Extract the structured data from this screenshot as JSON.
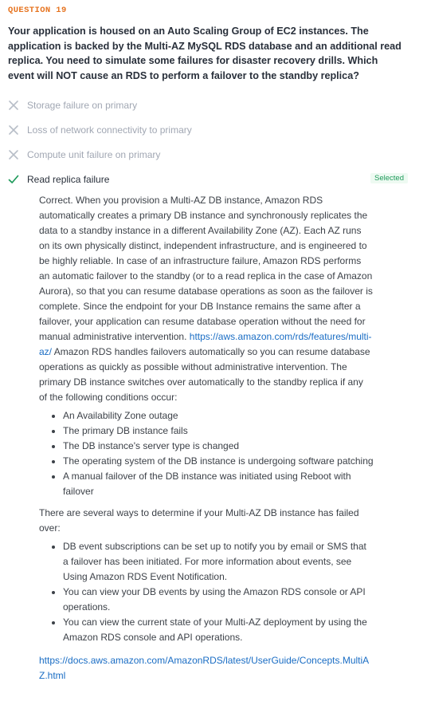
{
  "question": {
    "number_label": "QUESTION 19",
    "prompt": "Your application is housed on an Auto Scaling Group of EC2 instances. The application is backed by the Multi-AZ MySQL RDS database and an additional read replica. You need to simulate some failures for disaster recovery drills. Which event will NOT cause an RDS to perform a failover to the standby replica?"
  },
  "answers": [
    {
      "label": "Storage failure on primary",
      "state": "incorrect"
    },
    {
      "label": "Loss of network connectivity to primary",
      "state": "incorrect"
    },
    {
      "label": "Compute unit failure on primary",
      "state": "incorrect"
    },
    {
      "label": "Read replica failure",
      "state": "correct",
      "badge": "Selected"
    }
  ],
  "explanation": {
    "intro": "Correct. When you provision a Multi-AZ DB instance, Amazon RDS automatically creates a primary DB instance and synchronously replicates the data to a standby instance in a different Availability Zone (AZ). Each AZ runs on its own physically distinct, independent infrastructure, and is engineered to be highly reliable. In case of an infrastructure failure, Amazon RDS performs an automatic failover to the standby (or to a read replica in the case of Amazon Aurora), so that you can resume database operations as soon as the failover is complete. Since the endpoint for your DB Instance remains the same after a failover, your application can resume database operation without the need for manual administrative intervention.",
    "link1": "https://aws.amazon.com/rds/features/multi-az/",
    "after_link1": " Amazon RDS handles failovers automatically so you can resume database operations as quickly as possible without administrative intervention. The primary DB instance switches over automatically to the standby replica if any of the following conditions occur:",
    "conditions": [
      "An Availability Zone outage",
      "The primary DB instance fails",
      "The DB instance's server type is changed",
      "The operating system of the DB instance is undergoing software patching",
      "A manual failover of the DB instance was initiated using Reboot with failover"
    ],
    "para2": "There are several ways to determine if your Multi-AZ DB instance has failed over:",
    "ways": [
      "DB event subscriptions can be set up to notify you by email or SMS that a failover has been initiated. For more information about events, see Using Amazon RDS Event Notification.",
      "You can view your DB events by using the Amazon RDS console or API operations.",
      "You can view the current state of your Multi-AZ deployment by using the Amazon RDS console and API operations."
    ],
    "link2": "https://docs.aws.amazon.com/AmazonRDS/latest/UserGuide/Concepts.MultiAZ.html"
  },
  "colors": {
    "question_number": "#e6731f",
    "incorrect_mark": "#b8bec8",
    "correct_mark": "#1e9a5a",
    "link": "#1a6dc4"
  }
}
